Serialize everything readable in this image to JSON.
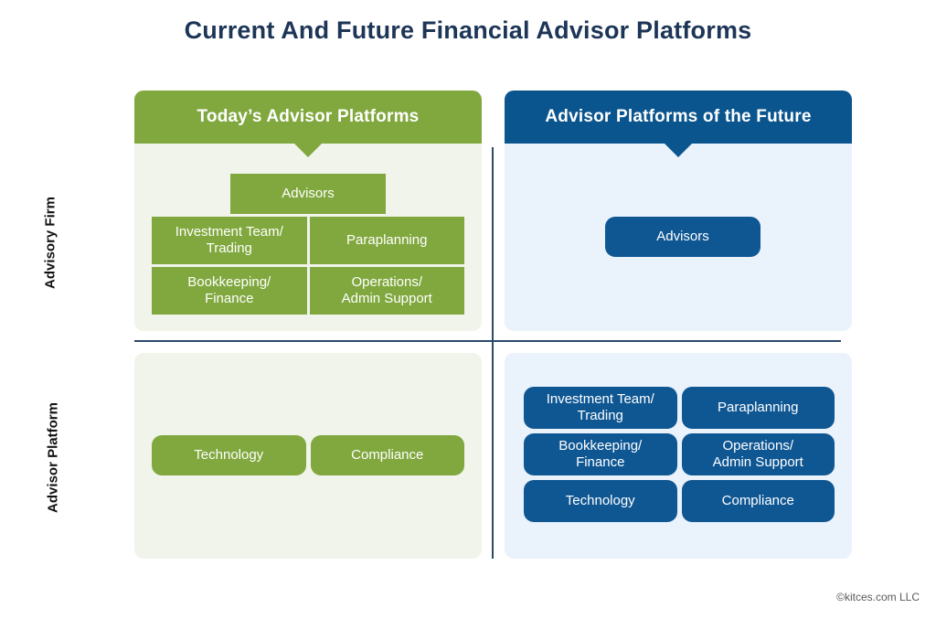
{
  "page": {
    "title": "Current And Future Financial Advisor Platforms",
    "footer_credit": "©kitces.com LLC"
  },
  "axes": {
    "row_labels": [
      {
        "id": "advisory-firm",
        "label": "Advisory Firm"
      },
      {
        "id": "advisor-platform",
        "label": "Advisor Platform"
      }
    ]
  },
  "columns": [
    {
      "id": "today",
      "header": "Today’s Advisor Platforms",
      "accent": "#80a83e",
      "panel_bg": "#f1f4ea"
    },
    {
      "id": "future",
      "header": "Advisor Platforms of the Future",
      "accent": "#0b558f",
      "panel_bg": "#eaf2fb"
    }
  ],
  "quadrants": {
    "top_left": {
      "lead_tile": "Advisors",
      "rows": [
        [
          "Investment Team/\nTrading",
          "Paraplanning"
        ],
        [
          "Bookkeeping/\nFinance",
          "Operations/\nAdmin Support"
        ]
      ],
      "tiles": {
        "advisors": "Advisors",
        "investment_team": "Investment Team/",
        "investment_team_2": "Trading",
        "paraplanning": "Paraplanning",
        "bookkeeping": "Bookkeeping/",
        "bookkeeping_2": "Finance",
        "operations": "Operations/",
        "operations_2": "Admin Support"
      }
    },
    "top_right": {
      "tiles": {
        "advisors": "Advisors"
      }
    },
    "bottom_left": {
      "tiles": {
        "technology": "Technology",
        "compliance": "Compliance"
      }
    },
    "bottom_right": {
      "tiles": {
        "investment_team": "Investment Team/",
        "investment_team_2": "Trading",
        "paraplanning": "Paraplanning",
        "bookkeeping": "Bookkeeping/",
        "bookkeeping_2": "Finance",
        "operations": "Operations/",
        "operations_2": "Admin Support",
        "technology": "Technology",
        "compliance": "Compliance"
      }
    }
  },
  "colors": {
    "title": "#1d3557",
    "green": "#80a83e",
    "blue": "#0b558f",
    "blue_tile": "#0f5793",
    "green_panel_bg": "#f1f4ea",
    "blue_panel_bg": "#eaf2fb",
    "divider": "#2b4a6b"
  }
}
